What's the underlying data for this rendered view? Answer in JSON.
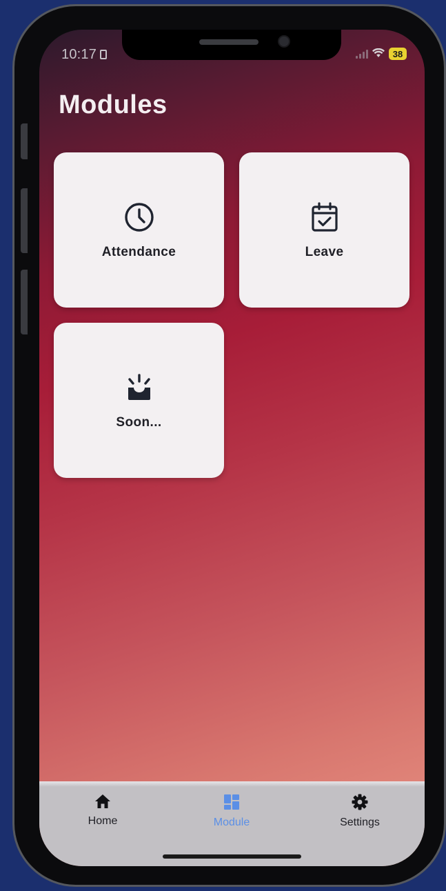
{
  "status_bar": {
    "time": "10:17",
    "battery": "38"
  },
  "page": {
    "title": "Modules"
  },
  "modules": [
    {
      "label": "Attendance",
      "icon": "clock-icon"
    },
    {
      "label": "Leave",
      "icon": "calendar-check-icon"
    },
    {
      "label": "Soon...",
      "icon": "coming-soon-icon"
    }
  ],
  "tabbar": {
    "items": [
      {
        "label": "Home",
        "icon": "home-icon",
        "active": false
      },
      {
        "label": "Module",
        "icon": "grid-icon",
        "active": true
      },
      {
        "label": "Settings",
        "icon": "gear-icon",
        "active": false
      }
    ]
  },
  "colors": {
    "accent": "#5b8fe6",
    "card_background": "#f3f0f2",
    "icon_dark": "#1f2430",
    "tabbar_background": "#c2c0c4",
    "battery": "#e9d231"
  }
}
